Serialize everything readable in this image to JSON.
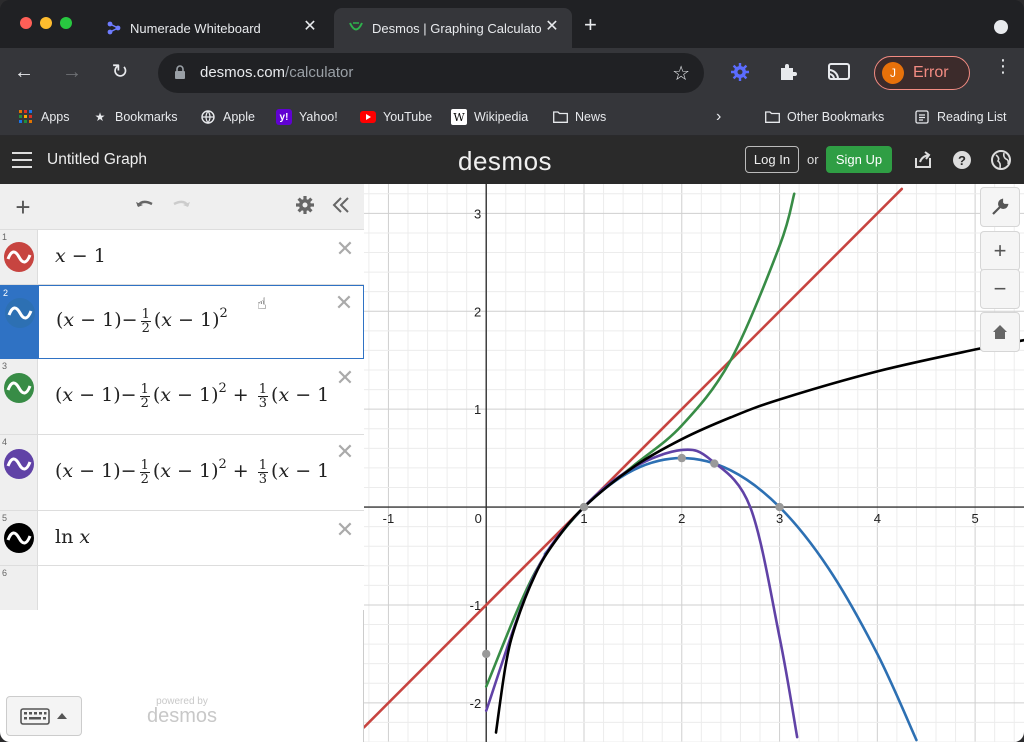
{
  "browser": {
    "tabs": [
      {
        "title": "Numerade Whiteboard",
        "favicon": "numerade-icon"
      },
      {
        "title": "Desmos | Graphing Calculator",
        "favicon": "desmos-icon",
        "active": true
      }
    ],
    "url_host": "desmos.com",
    "url_path": "/calculator",
    "profile_initial": "J",
    "profile_status": "Error",
    "bookmarks": [
      "Apps",
      "Bookmarks",
      "Apple",
      "Yahoo!",
      "YouTube",
      "Wikipedia",
      "News"
    ],
    "other_bookmarks": "Other Bookmarks",
    "reading_list": "Reading List"
  },
  "desmos": {
    "graph_title": "Untitled Graph",
    "logo": "desmos",
    "login": "Log In",
    "or": "or",
    "signup": "Sign Up",
    "powered_by": "powered by",
    "powered_logo": "desmos"
  },
  "expressions": [
    {
      "index": "1",
      "color": "#c74440",
      "text": "x − 1"
    },
    {
      "index": "2",
      "color": "#2d70b3",
      "selected": true,
      "text": "(x − 1) − ½ (x − 1)²"
    },
    {
      "index": "3",
      "color": "#388c46",
      "text": "(x − 1) − ½ (x − 1)² + ⅓ (x − 1"
    },
    {
      "index": "4",
      "color": "#6042a6",
      "text": "(x − 1) − ½ (x − 1)² + ⅓ (x − 1"
    },
    {
      "index": "5",
      "color": "#000000",
      "text": "ln x"
    },
    {
      "index": "6"
    }
  ],
  "chart_data": {
    "type": "line",
    "xlim": [
      -1.25,
      5.5
    ],
    "ylim": [
      -2.4,
      3.3
    ],
    "grid": true,
    "x_ticks": [
      "-1",
      "0",
      "1",
      "2",
      "3",
      "4",
      "5"
    ],
    "y_ticks": [
      "3",
      "2",
      "1",
      "-1",
      "-2"
    ],
    "series": [
      {
        "color": "#c74440",
        "points": [
          [
            -1.25,
            -2.25
          ],
          [
            4.25,
            3.25
          ]
        ]
      },
      {
        "color": "#2d70b3",
        "points": [
          [
            0.6,
            -0.48
          ],
          [
            1.0,
            0.0
          ],
          [
            1.5,
            0.375
          ],
          [
            2.0,
            0.5
          ],
          [
            2.5,
            0.375
          ],
          [
            3.0,
            0.0
          ],
          [
            3.5,
            -0.625
          ],
          [
            4.0,
            -1.5
          ],
          [
            4.4,
            -2.38
          ]
        ]
      },
      {
        "color": "#388c46",
        "points": [
          [
            0.0,
            -1.833
          ],
          [
            0.5,
            -0.667
          ],
          [
            1.0,
            0.0
          ],
          [
            1.5,
            0.417
          ],
          [
            2.0,
            0.833
          ],
          [
            2.5,
            1.5
          ],
          [
            3.0,
            2.667
          ],
          [
            3.15,
            3.2
          ]
        ]
      },
      {
        "color": "#6042a6",
        "points": [
          [
            0.0,
            -2.08
          ],
          [
            0.5,
            -0.68
          ],
          [
            1.0,
            0.0
          ],
          [
            1.5,
            0.4
          ],
          [
            2.0,
            0.583
          ],
          [
            2.3,
            0.48
          ],
          [
            2.7,
            0.0
          ],
          [
            3.0,
            -1.33
          ],
          [
            3.18,
            -2.35
          ]
        ]
      },
      {
        "color": "#000000",
        "points": [
          [
            0.1,
            -2.303
          ],
          [
            0.2,
            -1.609
          ],
          [
            0.3,
            -1.204
          ],
          [
            0.5,
            -0.693
          ],
          [
            0.7,
            -0.357
          ],
          [
            1.0,
            0.0
          ],
          [
            1.5,
            0.405
          ],
          [
            2.0,
            0.693
          ],
          [
            2.5,
            0.916
          ],
          [
            3.0,
            1.099
          ],
          [
            4.0,
            1.386
          ],
          [
            5.0,
            1.609
          ],
          [
            5.5,
            1.705
          ]
        ]
      }
    ],
    "points_marked": [
      [
        0.0,
        -1.5
      ],
      [
        1.0,
        0.0
      ],
      [
        2.0,
        0.5
      ],
      [
        2.333,
        0.444
      ],
      [
        3.0,
        0.0
      ]
    ]
  }
}
